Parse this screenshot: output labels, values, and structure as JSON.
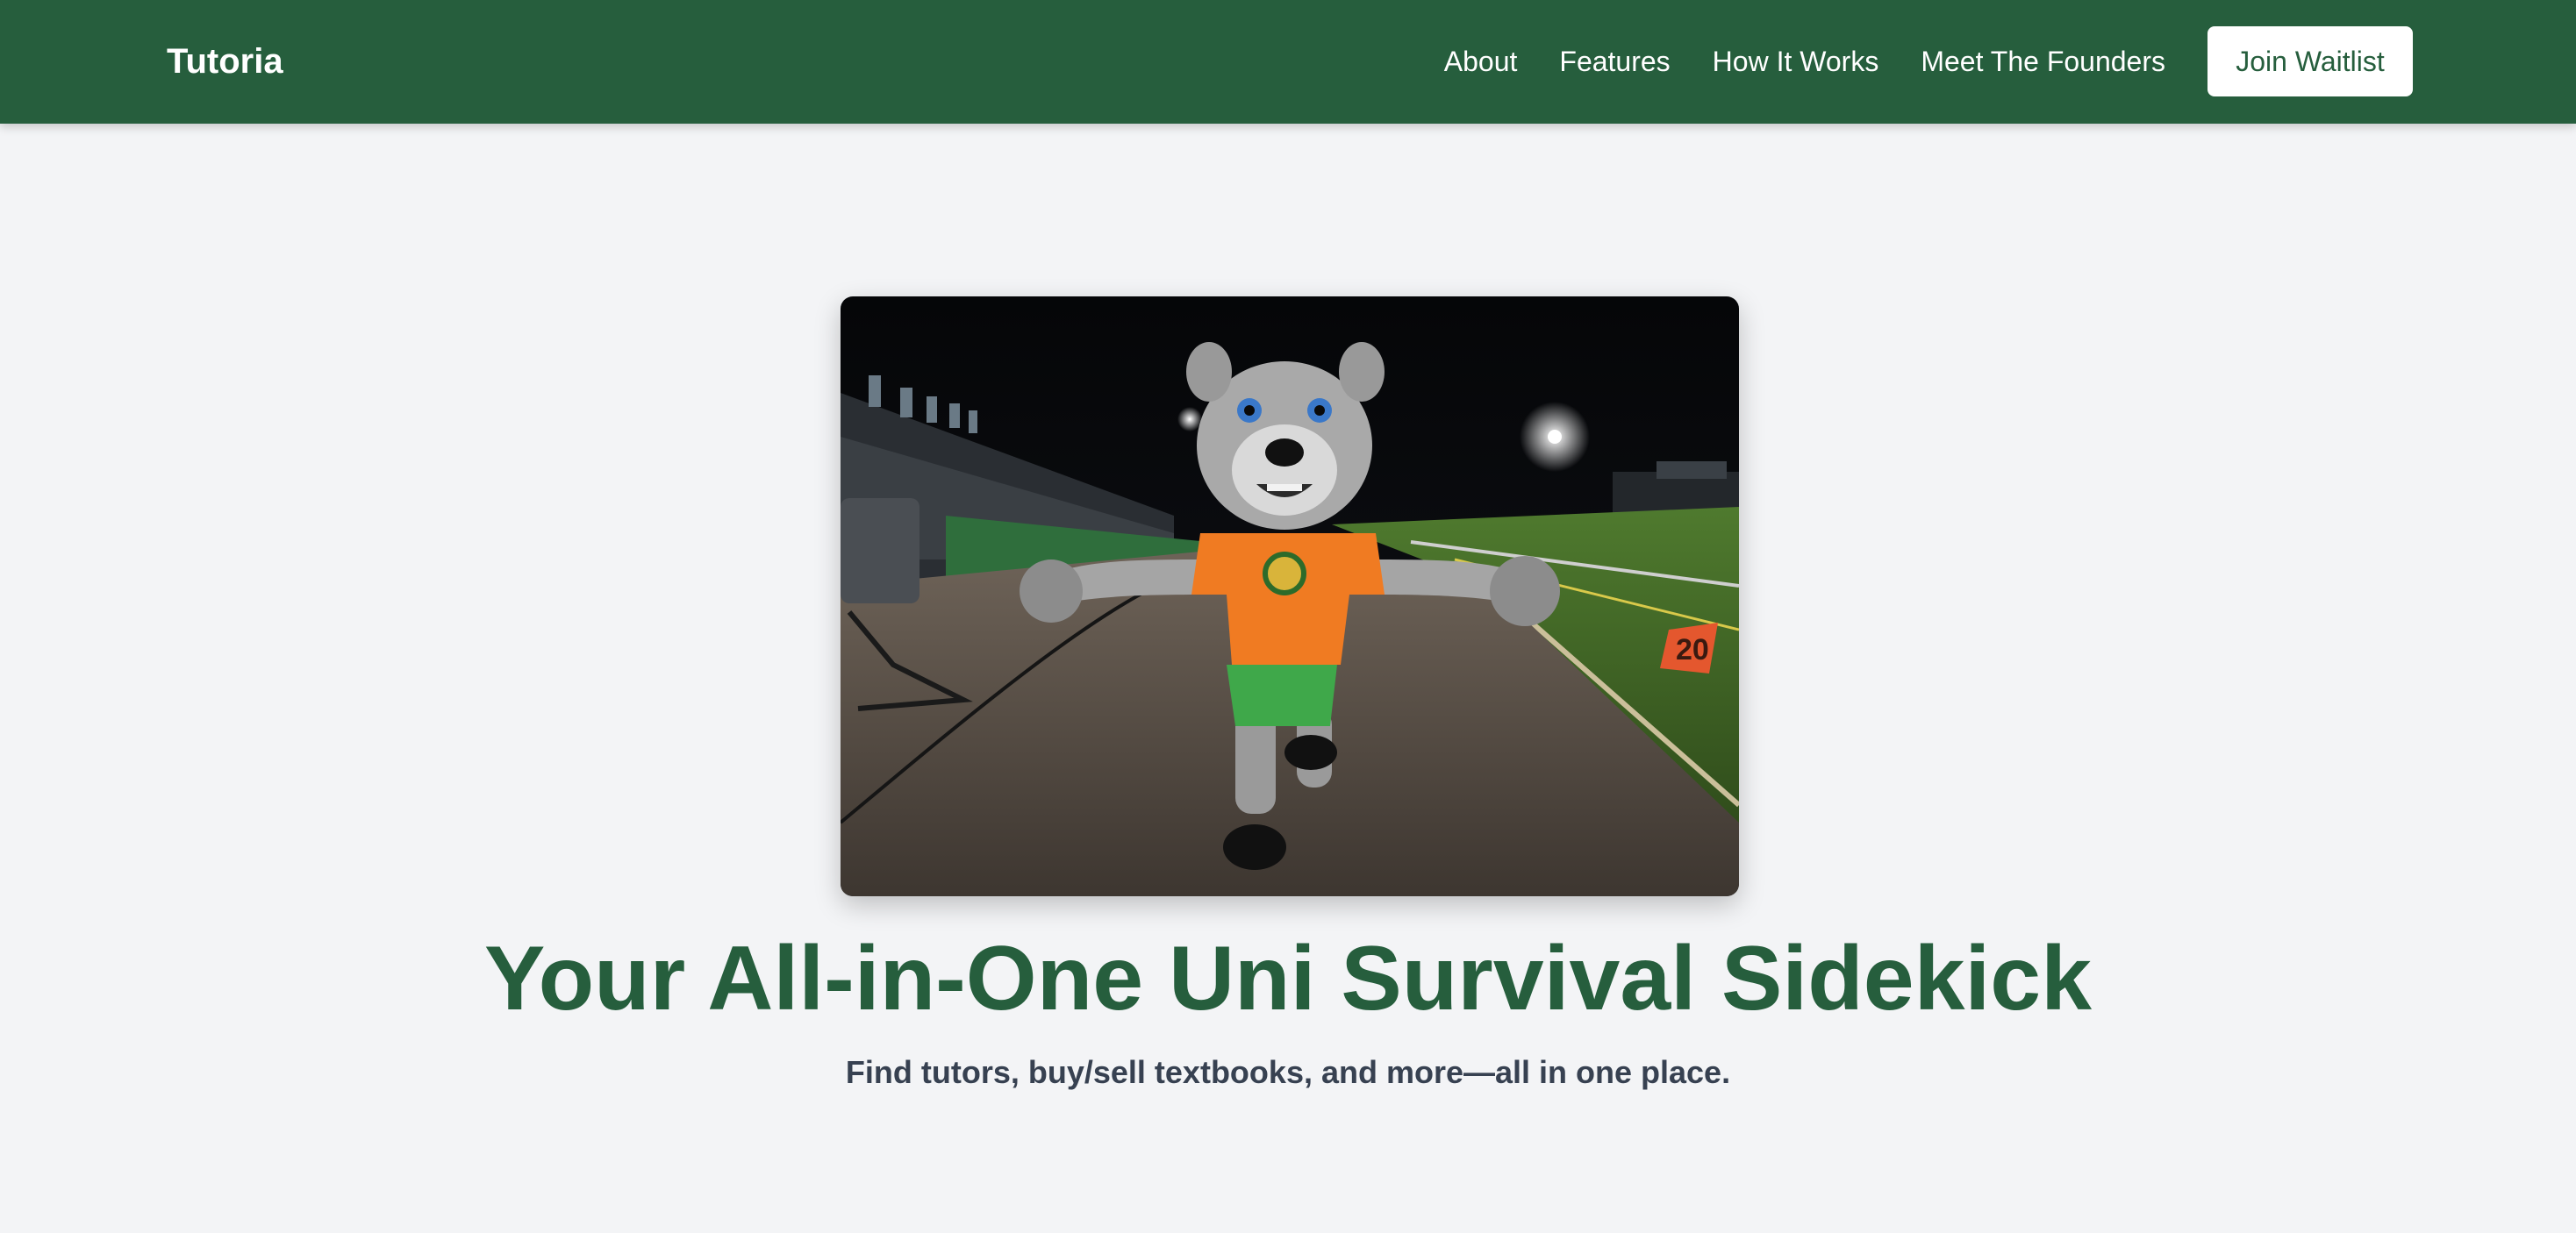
{
  "header": {
    "brand": "Tutoria",
    "nav": [
      "About",
      "Features",
      "How It Works",
      "Meet The Founders"
    ],
    "cta_label": "Join Waitlist"
  },
  "hero": {
    "title": "Your All-in-One Uni Survival Sidekick",
    "subtitle": "Find tutors, buy/sell textbooks, and more—all in one place.",
    "yard_marker": "20"
  },
  "colors": {
    "brand_green": "#265e3d",
    "page_background": "#f3f4f6",
    "subtitle_text": "#374151",
    "button_background": "#ffffff"
  }
}
